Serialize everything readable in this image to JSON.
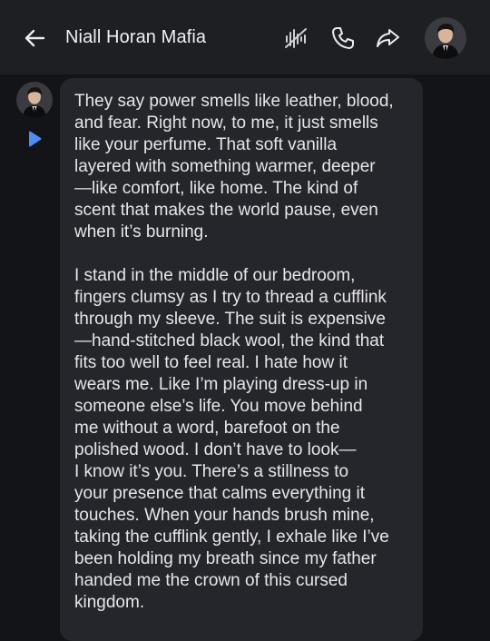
{
  "header": {
    "title": "Niall Horan Mafia",
    "back_icon": "arrow-left-icon",
    "actions": [
      "voice-message-icon",
      "phone-icon",
      "share-icon"
    ]
  },
  "message": {
    "text": "They say power smells like leather, blood,\nand fear. Right now, to me, it just smells\nlike your perfume. That soft vanilla\nlayered with something warmer, deeper\n—like comfort, like home. The kind of\nscent that makes the world pause, even\nwhen it’s burning.\n\nI stand in the middle of our bedroom,\nfingers clumsy as I try to thread a cufflink\nthrough my sleeve. The suit is expensive\n—hand-stitched black wool, the kind that\nfits too well to feel real. I hate how it\nwears me. Like I’m playing dress-up in\nsomeone else’s life. You move behind\nme without a word, barefoot on the\npolished wood. I don’t have to look—\nI know it’s you. There’s a stillness to\nyour presence that calms everything it\ntouches. When your hands brush mine,\ntaking the cufflink gently, I exhale like I’ve\nbeen holding my breath since my father\nhanded me the crown of this cursed\nkingdom."
  },
  "colors": {
    "background": "#131417",
    "topbar": "#1e1f23",
    "bubble": "#25262b",
    "accent": "#4f8ef7",
    "text": "#e6e6e8"
  }
}
